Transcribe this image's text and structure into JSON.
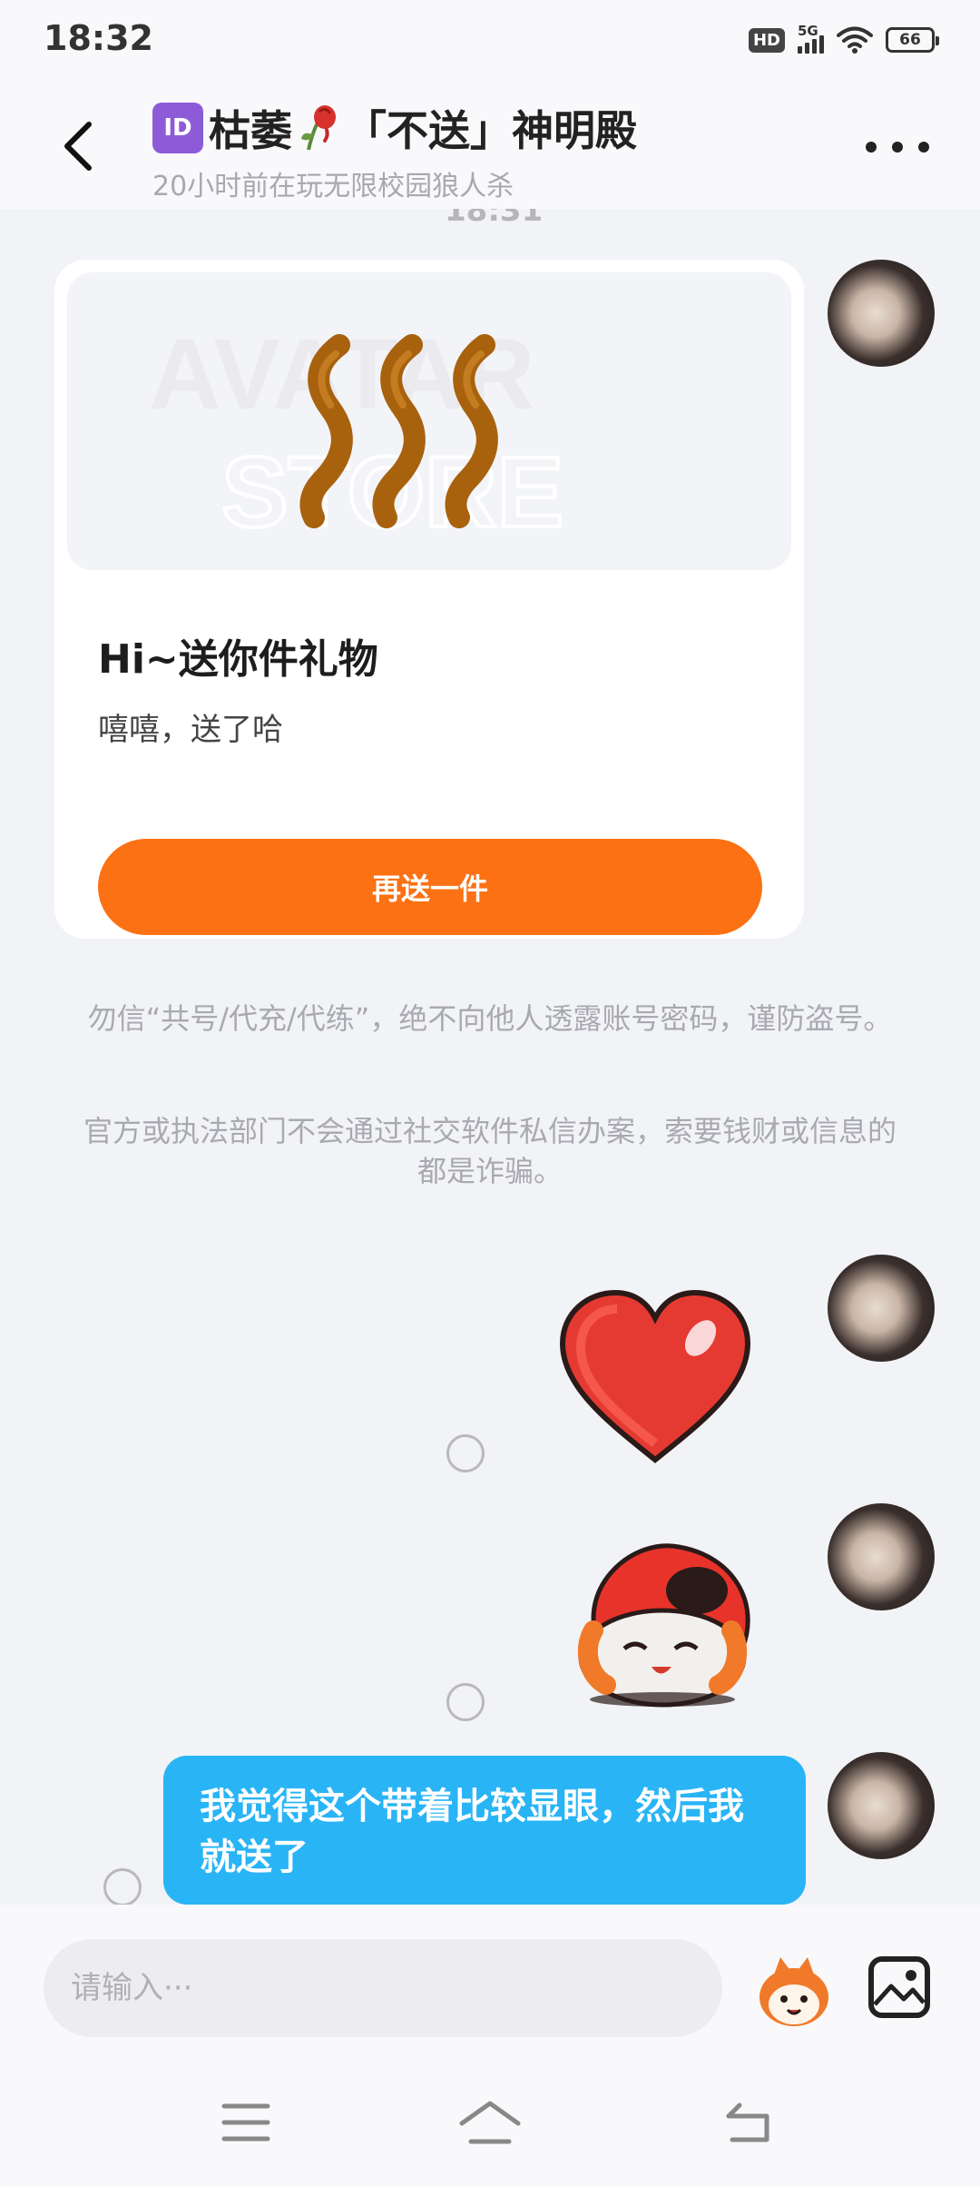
{
  "status_bar": {
    "time": "18:32",
    "hd_label": "HD",
    "network_label": "5G",
    "battery_level": "66"
  },
  "header": {
    "id_badge": "ID",
    "title": "枯萎",
    "title_suffix": "「不送」神明殿",
    "subtitle": "20小时前在玩无限校园狼人杀"
  },
  "chat": {
    "partial_timestamp": "18:31",
    "gift_card": {
      "banner_watermark_top": "AVATAR",
      "banner_watermark_bottom": "STORE",
      "title": "Hi~送你件礼物",
      "message": "嘻嘻，送了哈",
      "button_label": "再送一件"
    },
    "notices": [
      "勿信“共号/代充/代练”，绝不向他人透露账号密码，谨防盗号。",
      "官方或执法部门不会通过社交软件私信办案，索要钱财或信息的都是诈骗。"
    ],
    "text_message": "我觉得这个带着比较显眼，然后我就送了"
  },
  "input": {
    "placeholder": "请输入···"
  },
  "colors": {
    "accent_orange": "#fb7113",
    "bubble_blue": "#29b4f6",
    "background": "#f2f3f7"
  },
  "icons": [
    "back-icon",
    "more-icon",
    "emoji-icon",
    "image-icon",
    "menu-icon",
    "home-icon",
    "back-nav-icon"
  ]
}
